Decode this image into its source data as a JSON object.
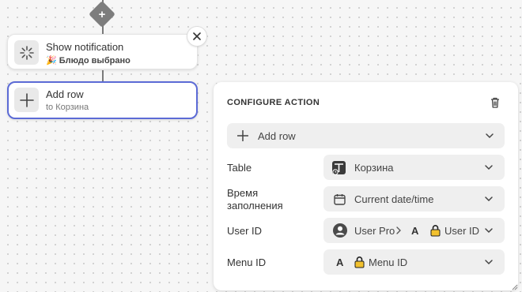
{
  "canvas": {
    "add_step_symbol": "+",
    "nodes": [
      {
        "title": "Show notification",
        "subtitle_emoji": "🎉",
        "subtitle": "Блюдо выбрано",
        "icon": "loader-icon",
        "selected": false
      },
      {
        "title": "Add row",
        "subtitle": "to Корзина",
        "icon": "plus-icon",
        "selected": true
      }
    ]
  },
  "panel": {
    "title": "CONFIGURE ACTION",
    "action_select": {
      "label": "Add row",
      "icon": "plus-icon"
    },
    "fields": [
      {
        "label": "Table",
        "value": "Корзина",
        "icon": "table-icon"
      },
      {
        "label_line1": "Время",
        "label_line2": "заполнения",
        "value": "Current date/time",
        "icon": "calendar-icon"
      },
      {
        "label": "User ID",
        "prefix": "User Pro",
        "value": "User ID",
        "icon": "user-icon"
      },
      {
        "label": "Menu ID",
        "value": "Menu ID",
        "icon": "lock-icon"
      }
    ],
    "text_icon_glyph": "A"
  },
  "colors": {
    "selected_border": "#5c6bd6",
    "canvas_bg": "#f6f6f6",
    "lock": "#f2c12e"
  }
}
